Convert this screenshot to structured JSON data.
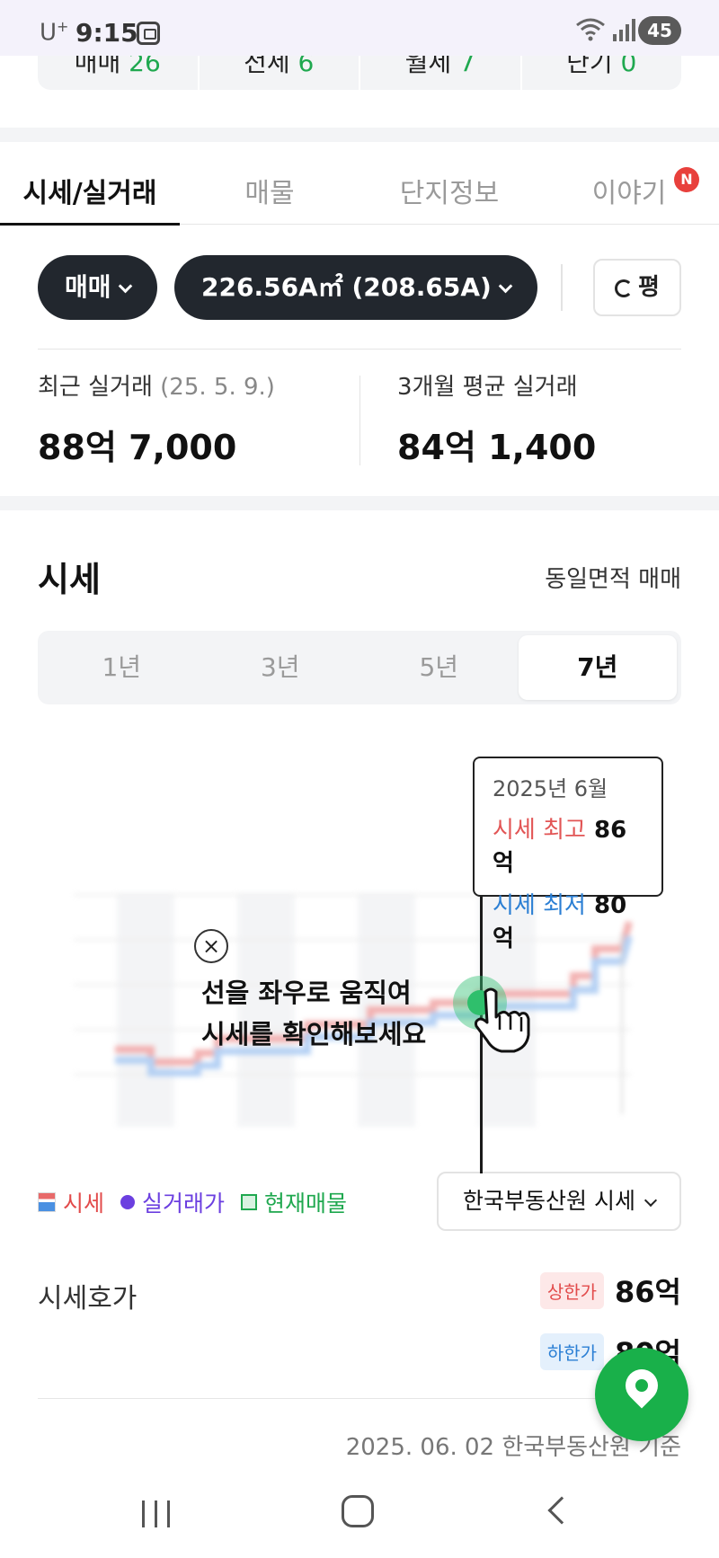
{
  "status_bar": {
    "carrier": "U",
    "carrier_plus": "+",
    "time": "9:15",
    "battery": "45"
  },
  "top_stats": [
    {
      "label": "매매",
      "count": "26"
    },
    {
      "label": "전세",
      "count": "6"
    },
    {
      "label": "월세",
      "count": "7"
    },
    {
      "label": "단기",
      "count": "0"
    }
  ],
  "tabs": [
    {
      "label": "시세/실거래",
      "active": true
    },
    {
      "label": "매물",
      "active": false
    },
    {
      "label": "단지정보",
      "active": false
    },
    {
      "label": "이야기",
      "active": false
    }
  ],
  "new_badge": "N",
  "filters": {
    "trade_type": "매매",
    "area": "226.56A㎡ (208.65A)",
    "unit_toggle": "평"
  },
  "summary": {
    "recent_label": "최근 실거래",
    "recent_date": "(25. 5. 9.)",
    "recent_value": "88억 7,000",
    "avg_label": "3개월 평균 실거래",
    "avg_value": "84억 1,400"
  },
  "price_section": {
    "title": "시세",
    "same_area_link": "동일면적 매매"
  },
  "periods": [
    {
      "label": "1년",
      "active": false
    },
    {
      "label": "3년",
      "active": false
    },
    {
      "label": "5년",
      "active": false
    },
    {
      "label": "7년",
      "active": true
    }
  ],
  "tooltip": {
    "date": "2025년 6월",
    "high_label": "시세 최고",
    "high_value": "86억",
    "low_label": "시세 최저",
    "low_value": "80억"
  },
  "hint": {
    "close": "×",
    "line1": "선을 좌우로 움직여",
    "line2": "시세를 확인해보세요"
  },
  "legend": {
    "price": "시세",
    "real_trade": "실거래가",
    "listing": "현재매물"
  },
  "source_select": "한국부동산원 시세",
  "quote": {
    "label": "시세호가",
    "upper_tag": "상한가",
    "upper_value": "86억",
    "lower_tag": "하한가",
    "lower_value": "80억"
  },
  "basis": "2025. 06. 02 한국부동산원 기준",
  "colors": {
    "accent_green": "#1fa84f",
    "price_red": "#e24b4b",
    "price_blue": "#2b7fd4",
    "dark_chip": "#22272e"
  }
}
